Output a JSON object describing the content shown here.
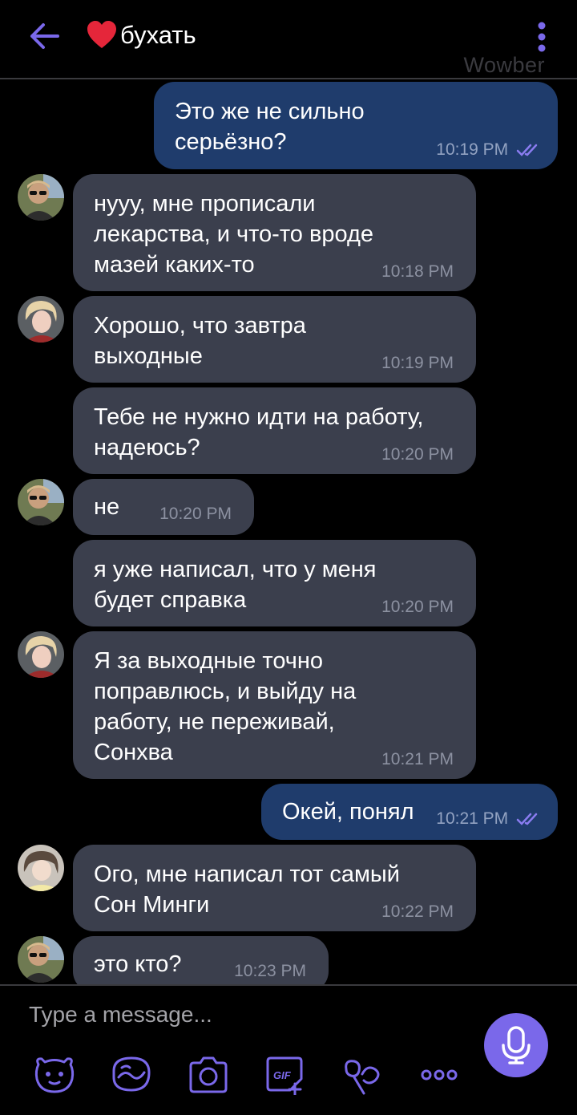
{
  "header": {
    "title": "бухать",
    "watermark": "Wowber",
    "back_icon": "arrow-left-icon",
    "menu_icon": "kebab-menu-icon",
    "heart_icon": "heart-icon"
  },
  "colors": {
    "background": "#000000",
    "incoming_bubble": "#3b3f4d",
    "outgoing_bubble": "#1f3c6c",
    "accent": "#7a68ea"
  },
  "messages": [
    {
      "direction": "out",
      "text": "Это же не сильно\nсерьёзно?",
      "time": "10:19 PM",
      "read": true
    },
    {
      "direction": "in",
      "avatar": "avatar-male-sunglasses",
      "text": "нууу, мне прописали\nлекарства, и что-то вроде\nмазей каких-то",
      "time": "10:18 PM"
    },
    {
      "direction": "in",
      "avatar": "avatar-blonde",
      "text": "Хорошо, что завтра\nвыходные",
      "time": "10:19 PM"
    },
    {
      "direction": "in",
      "text": "Тебе не нужно идти на работу,\nнадеюсь?",
      "time": "10:20 PM"
    },
    {
      "direction": "in",
      "avatar": "avatar-male-sunglasses",
      "text": "не",
      "time": "10:20 PM"
    },
    {
      "direction": "in",
      "text": "я уже написал, что у меня\nбудет справка",
      "time": "10:20 PM"
    },
    {
      "direction": "in",
      "avatar": "avatar-blonde",
      "text": "Я за выходные точно\nпоправлюсь, и выйду на\nработу, не переживай,\nСонхва",
      "time": "10:21 PM"
    },
    {
      "direction": "out",
      "text": "Окей, понял",
      "time": "10:21 PM",
      "read": true
    },
    {
      "direction": "in",
      "avatar": "avatar-girl",
      "text": "Ого, мне написал тот самый\nСон Минги",
      "time": "10:22 PM"
    },
    {
      "direction": "in",
      "avatar": "avatar-male-sunglasses",
      "text": "это кто?",
      "time": "10:23 PM"
    }
  ],
  "composer": {
    "placeholder": "Type a message...",
    "tools": [
      "sticker-bear-icon",
      "doodle-icon",
      "camera-icon",
      "gif-icon",
      "emoji-flower-icon",
      "more-dots-icon"
    ],
    "mic_icon": "microphone-icon"
  }
}
